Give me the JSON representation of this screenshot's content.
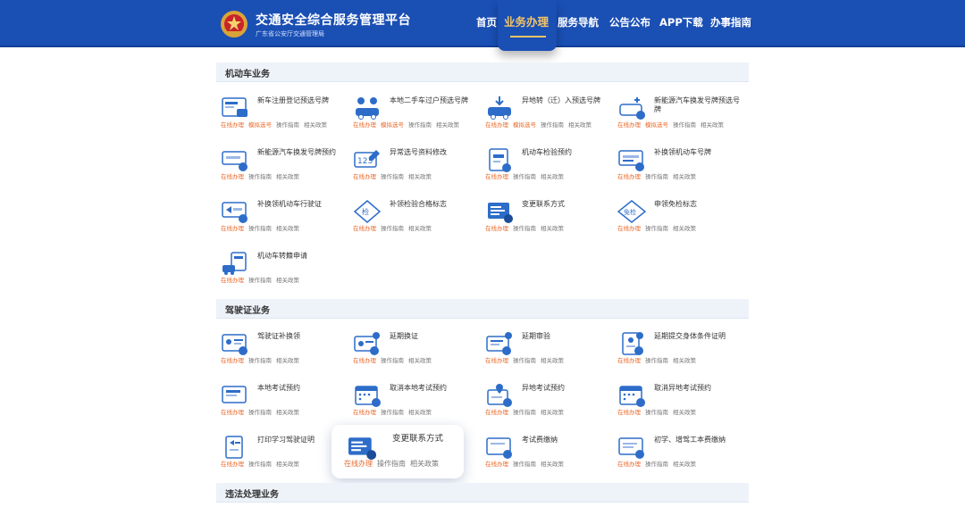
{
  "header": {
    "title": "交通安全综合服务管理平台",
    "subtitle": "广东省公安厅交通管理局",
    "nav": [
      "首页",
      "业务办理",
      "服务导航",
      "公告公布",
      "APP下载",
      "办事指南"
    ],
    "active_nav": "业务办理"
  },
  "links": {
    "online": "在线办理",
    "mock": "模拟选号",
    "guide": "操作指南",
    "policy": "相关政策"
  },
  "sections": {
    "vehicle": "机动车业务",
    "license": "驾驶证业务",
    "violation": "违法处理业务"
  },
  "vehicle_items": [
    "新车注册登记预选号牌",
    "本地二手车过户预选号牌",
    "异地转（迁）入预选号牌",
    "新能源汽车换发号牌预选号牌",
    "新能源汽车换发号牌预约",
    "异常选号资料修改",
    "机动车检验预约",
    "补换领机动车号牌",
    "补换领机动车行驶证",
    "补领检验合格标志",
    "变更联系方式",
    "申领免检标志",
    "机动车转籍申请"
  ],
  "license_items": [
    "驾驶证补换领",
    "延期换证",
    "延期审验",
    "延期提交身体条件证明",
    "本地考试预约",
    "取消本地考试预约",
    "异地考试预约",
    "取消异地考试预约",
    "打印学习驾驶证明",
    "变更联系方式",
    "考试费缴纳",
    "初学、增驾工本费缴纳"
  ],
  "icon_labels": {
    "plate_123": "123",
    "inspect": "检",
    "exempt": "免检"
  },
  "colors": {
    "header_blue": "#1a4fb4",
    "accent_gold": "#f3c469",
    "link_orange": "#e8692a",
    "icon_blue": "#2d6dc9"
  }
}
